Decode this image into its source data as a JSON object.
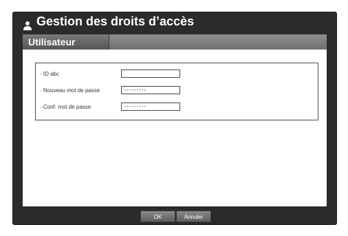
{
  "dialog": {
    "title": "Gestion des droits d’accès",
    "title_icon": "user-icon"
  },
  "tabs": [
    {
      "label": "Utilisateur",
      "active": true
    }
  ],
  "form": {
    "fields": [
      {
        "label": "· ID  abc",
        "value": ""
      },
      {
        "label": "· Nouveau mot de passe",
        "value": "•••••••••"
      },
      {
        "label": "· Conf. mot de passe",
        "value": "•••••••••"
      }
    ]
  },
  "buttons": {
    "ok": "OK",
    "cancel": "Annuler"
  },
  "colors": {
    "frame": "#2b2b2b",
    "tab_strip": "#7f7f7f",
    "panel": "#ffffff"
  }
}
